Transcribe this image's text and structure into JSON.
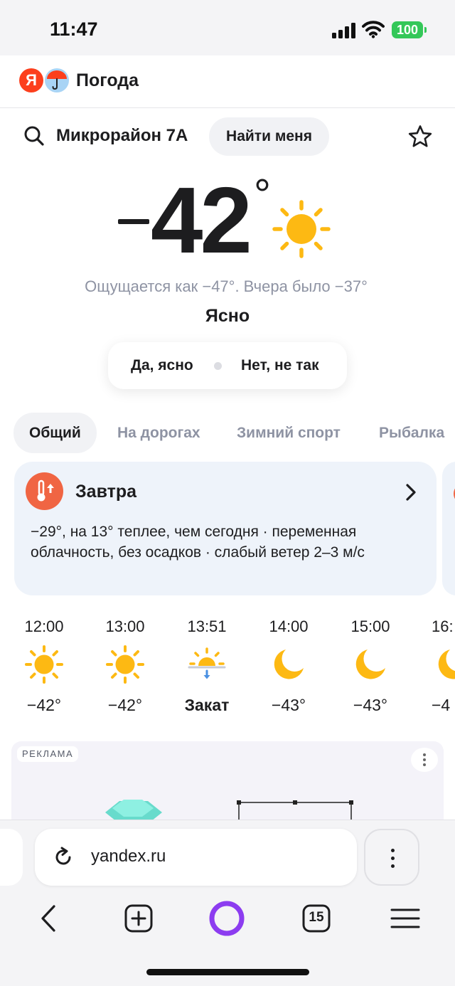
{
  "status_bar": {
    "time": "11:47",
    "battery": "100"
  },
  "header": {
    "logo_letter": "Я",
    "title": "Погода"
  },
  "location": {
    "name": "Микрорайон 7А",
    "find_me_label": "Найти меня"
  },
  "current": {
    "temperature": "42",
    "degree_sign": "°",
    "feels_like": "Ощущается как −47°. Вчера было −37°",
    "condition": "Ясно",
    "condition_icon": "sun-icon"
  },
  "feedback": {
    "yes_label": "Да, ясно",
    "no_label": "Нет, не так"
  },
  "tabs": [
    {
      "label": "Общий",
      "active": true
    },
    {
      "label": "На дорогах",
      "active": false
    },
    {
      "label": "Зимний спорт",
      "active": false
    },
    {
      "label": "Рыбалка",
      "active": false
    }
  ],
  "tomorrow_card": {
    "title": "Завтра",
    "text": "−29°, на 13° теплее, чем сегодня · переменная облачность, без осадков · слабый ветер 2–3 м/с",
    "icon": "thermometer-up-icon"
  },
  "hourly": [
    {
      "time": "12:00",
      "icon": "sun-icon",
      "value": "−42°"
    },
    {
      "time": "13:00",
      "icon": "sun-icon",
      "value": "−42°"
    },
    {
      "time": "13:51",
      "icon": "sunset-icon",
      "value": "Закат"
    },
    {
      "time": "14:00",
      "icon": "moon-icon",
      "value": "−43°"
    },
    {
      "time": "15:00",
      "icon": "moon-icon",
      "value": "−43°"
    },
    {
      "time": "16:",
      "icon": "moon-icon",
      "value": "−4"
    }
  ],
  "ad": {
    "label": "РЕКЛАМА"
  },
  "browser": {
    "url": "yandex.ru",
    "tabs_count": "15"
  },
  "colors": {
    "accent_red": "#fc3f1d",
    "sun_yellow": "#fdb913",
    "alice_purple": "#8c3cf0",
    "card_bg": "#eef3fa",
    "muted_text": "#8e93a3"
  }
}
